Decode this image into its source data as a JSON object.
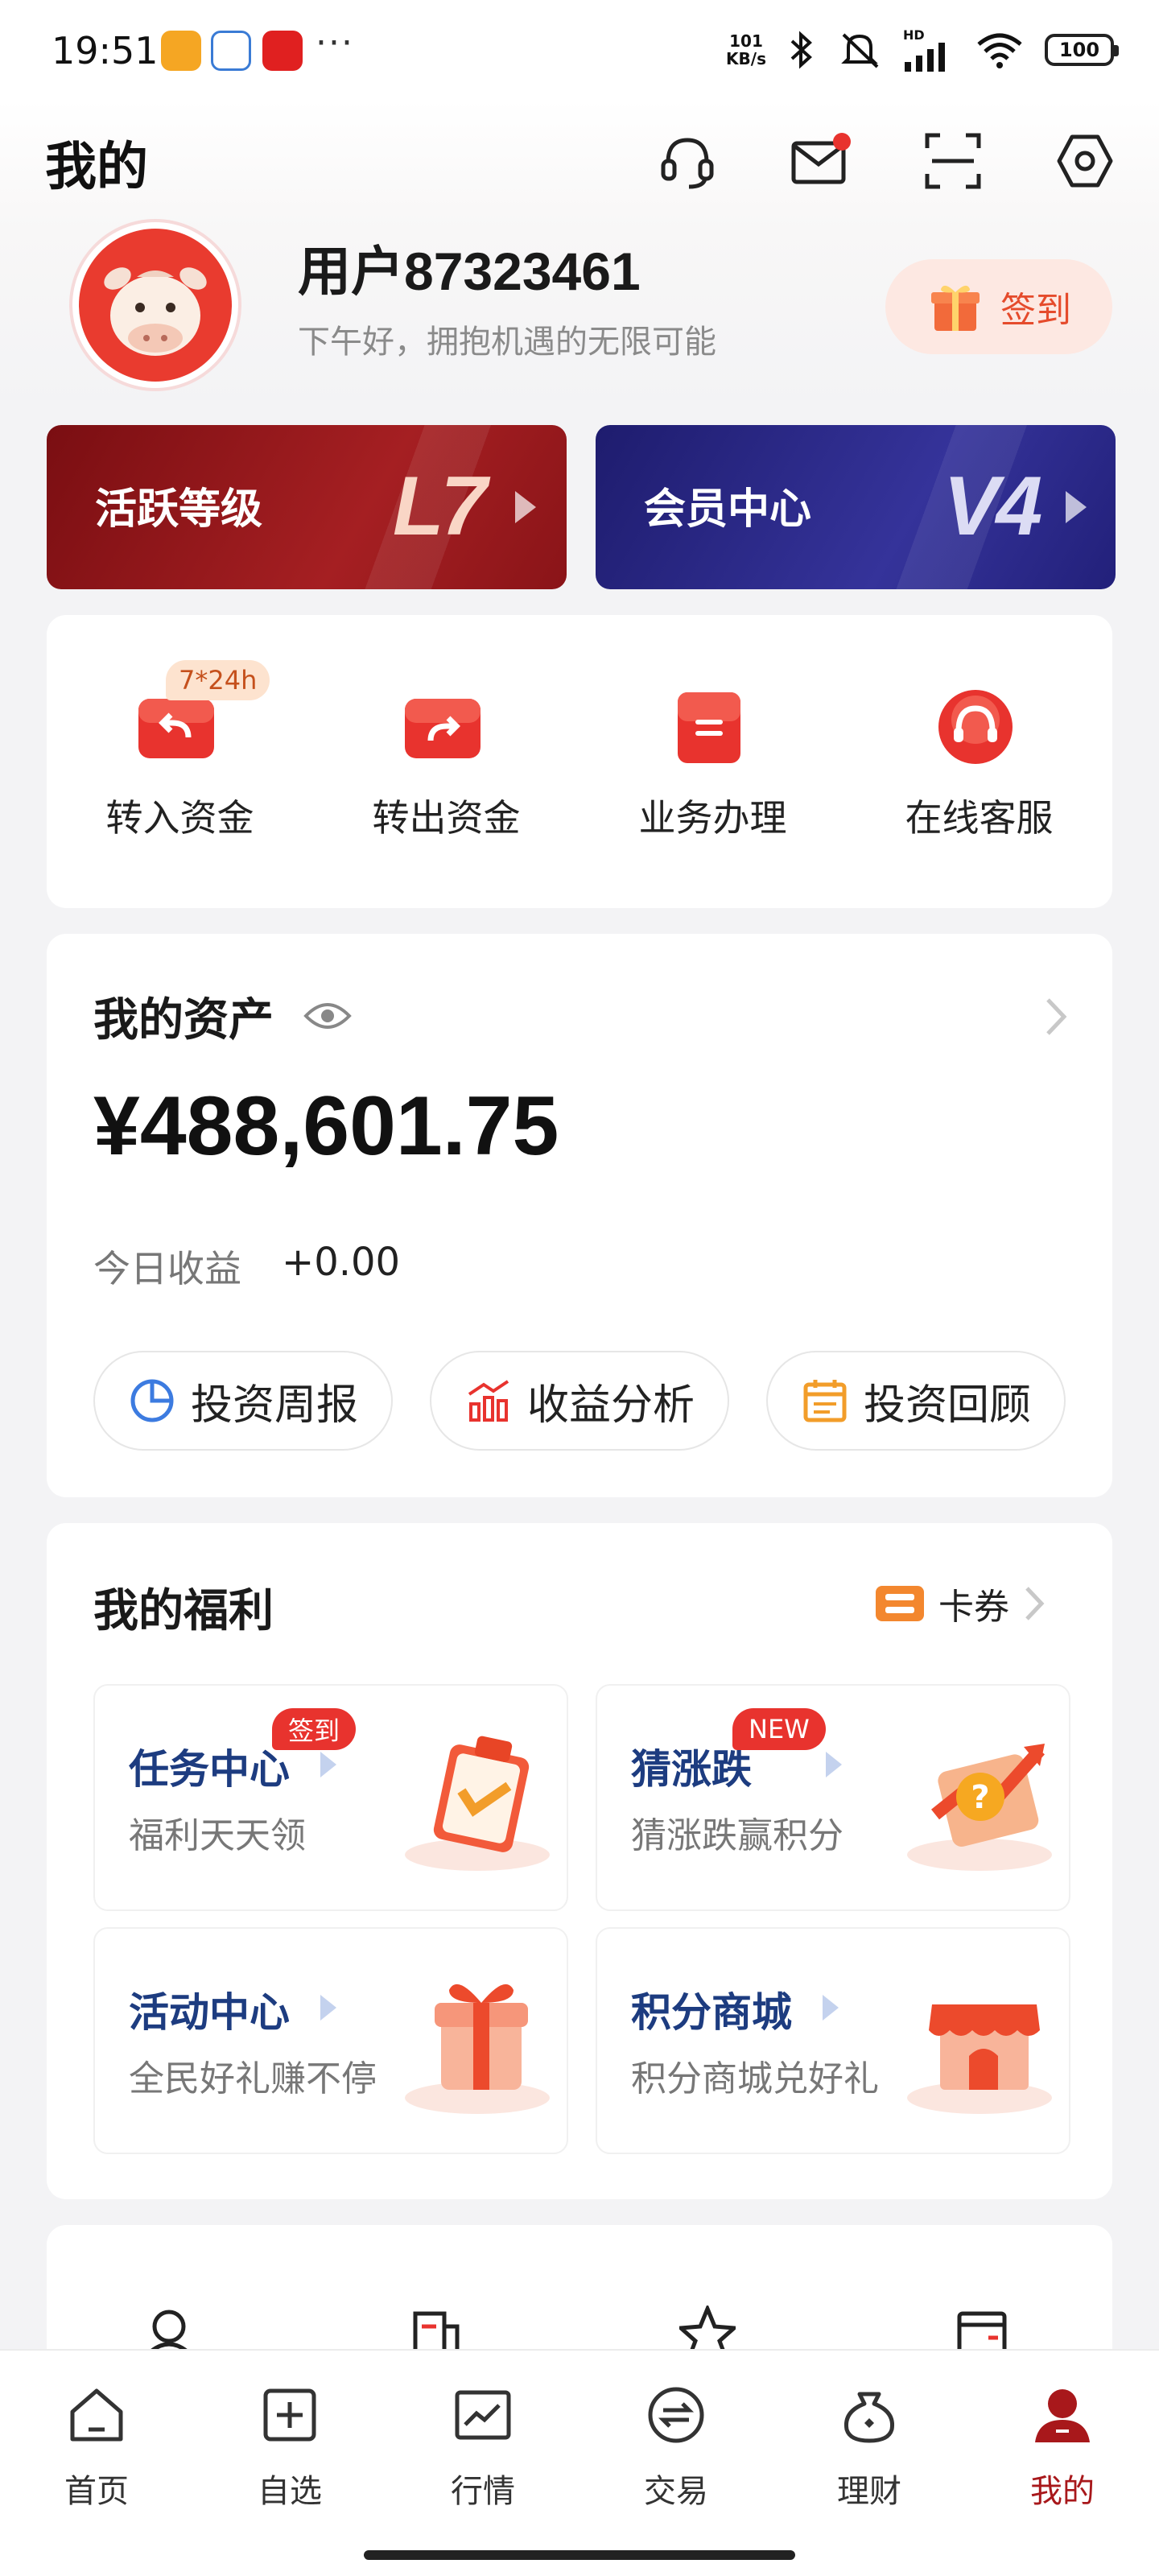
{
  "status_bar": {
    "time": "19:51",
    "more": "···",
    "net_speed_value": "101",
    "net_speed_unit": "KB/s",
    "hd_label": "HD",
    "battery": "100"
  },
  "header": {
    "title": "我的"
  },
  "profile": {
    "username": "用户87323461",
    "greeting": "下午好，拥抱机遇的无限可能",
    "sign_in_label": "签到"
  },
  "levels": {
    "active": {
      "label": "活跃等级",
      "value": "L7"
    },
    "member": {
      "label": "会员中心",
      "value": "V4"
    }
  },
  "quick_actions": [
    {
      "label": "转入资金",
      "badge": "7*24h",
      "icon": "transfer-in-icon"
    },
    {
      "label": "转出资金",
      "icon": "transfer-out-icon"
    },
    {
      "label": "业务办理",
      "icon": "business-icon"
    },
    {
      "label": "在线客服",
      "icon": "customer-service-icon"
    }
  ],
  "assets": {
    "title": "我的资产",
    "amount": "¥488,601.75",
    "today_label": "今日收益",
    "today_value": "+0.00",
    "buttons": [
      {
        "label": "投资周报",
        "icon": "pie-chart-icon"
      },
      {
        "label": "收益分析",
        "icon": "bar-chart-icon"
      },
      {
        "label": "投资回顾",
        "icon": "calendar-icon"
      }
    ]
  },
  "welfare": {
    "title": "我的福利",
    "coupon_label": "卡券",
    "items": [
      {
        "title": "任务中心",
        "subtitle": "福利天天领",
        "tag": "签到"
      },
      {
        "title": "猜涨跌",
        "subtitle": "猜涨跌赢积分",
        "tag": "NEW"
      },
      {
        "title": "活动中心",
        "subtitle": "全民好礼赚不停"
      },
      {
        "title": "积分商城",
        "subtitle": "积分商城兑好礼"
      }
    ]
  },
  "bottom_nav": [
    {
      "label": "首页",
      "icon": "home-icon"
    },
    {
      "label": "自选",
      "icon": "watchlist-icon"
    },
    {
      "label": "行情",
      "icon": "market-icon"
    },
    {
      "label": "交易",
      "icon": "trade-icon"
    },
    {
      "label": "理财",
      "icon": "wealth-icon"
    },
    {
      "label": "我的",
      "icon": "profile-icon",
      "active": true
    }
  ],
  "colors": {
    "accent": "#e8332e",
    "active_level_bg": "#8e1719",
    "member_bg": "#2a2884",
    "welfare_title": "#1d3c80"
  }
}
